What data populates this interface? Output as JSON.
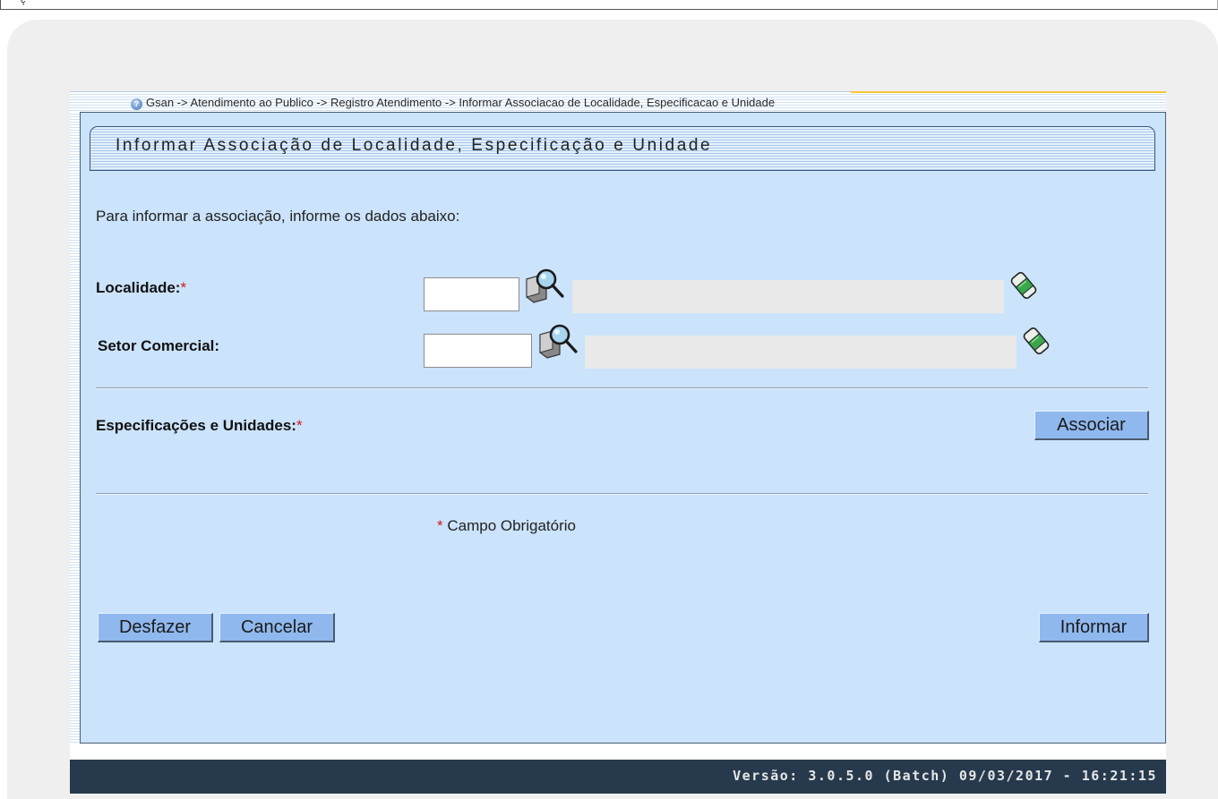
{
  "top_strip": {
    "text": "ç"
  },
  "breadcrumb": {
    "icon": "help-icon",
    "text": "Gsan -> Atendimento ao Publico -> Registro Atendimento -> Informar Associacao de Localidade, Especificacao e Unidade"
  },
  "page_title": "Informar Associação de Localidade, Especificação e Unidade",
  "intro": "Para informar a associação, informe os dados abaixo:",
  "form": {
    "localidade": {
      "label": "Localidade:",
      "required": "*",
      "value": "",
      "description": ""
    },
    "setor_comercial": {
      "label": "Setor Comercial:",
      "value": "",
      "description": ""
    },
    "especificacoes": {
      "label": "Especificações e Unidades:",
      "required": "*",
      "button": "Associar"
    }
  },
  "required_note": {
    "mark": "*",
    "text": "Campo Obrigatório"
  },
  "buttons": {
    "undo": "Desfazer",
    "cancel": "Cancelar",
    "submit": "Informar"
  },
  "footer": {
    "version": "Versão: 3.0.5.0 (Batch) 09/03/2017 - 16:21:15"
  },
  "colors": {
    "panel_background": "#cbe3fb",
    "button": "#8fb8ee",
    "footer": "#273a4d",
    "required_mark": "#d81818",
    "breadcrumb_accent": "#f5c533"
  }
}
